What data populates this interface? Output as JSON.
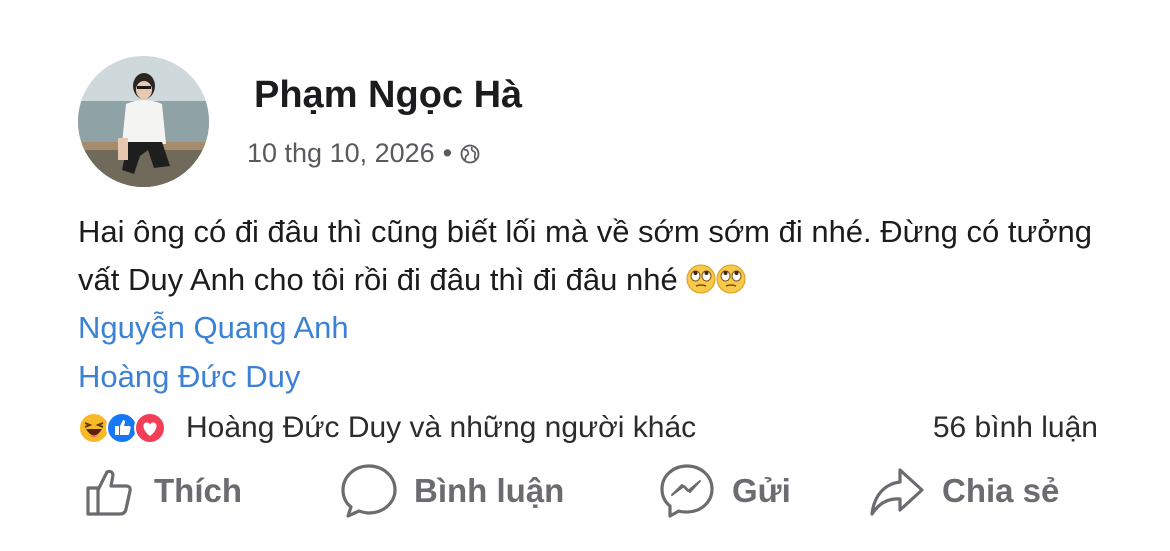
{
  "post": {
    "author": "Phạm Ngọc Hà",
    "date": "10 thg 10, 2026",
    "separator": "•",
    "privacy_icon": "globe-icon",
    "text": "Hai ông có đi đâu thì cũng biết lối mà về sớm sớm đi nhé. Đừng có tưởng vất Duy Anh cho tôi rồi đi đâu thì đi đâu nhé",
    "text_emojis": [
      "rolling-eyes-emoji",
      "rolling-eyes-emoji"
    ],
    "tags": [
      "Nguyễn Quang Anh",
      "Hoàng Đức Duy"
    ]
  },
  "reactions": {
    "icons": [
      "haha-reaction-icon",
      "like-reaction-icon",
      "love-reaction-icon"
    ],
    "summary": "Hoàng Đức Duy và những người khác",
    "comments": "56 bình luận"
  },
  "actions": {
    "like": "Thích",
    "comment": "Bình luận",
    "send": "Gửi",
    "share": "Chia sẻ"
  },
  "colors": {
    "link": "#3b82d6",
    "action_text": "#6b6b70",
    "like_blue": "#1877f2",
    "love_red": "#f33e58",
    "haha_yellow": "#f7b928"
  }
}
